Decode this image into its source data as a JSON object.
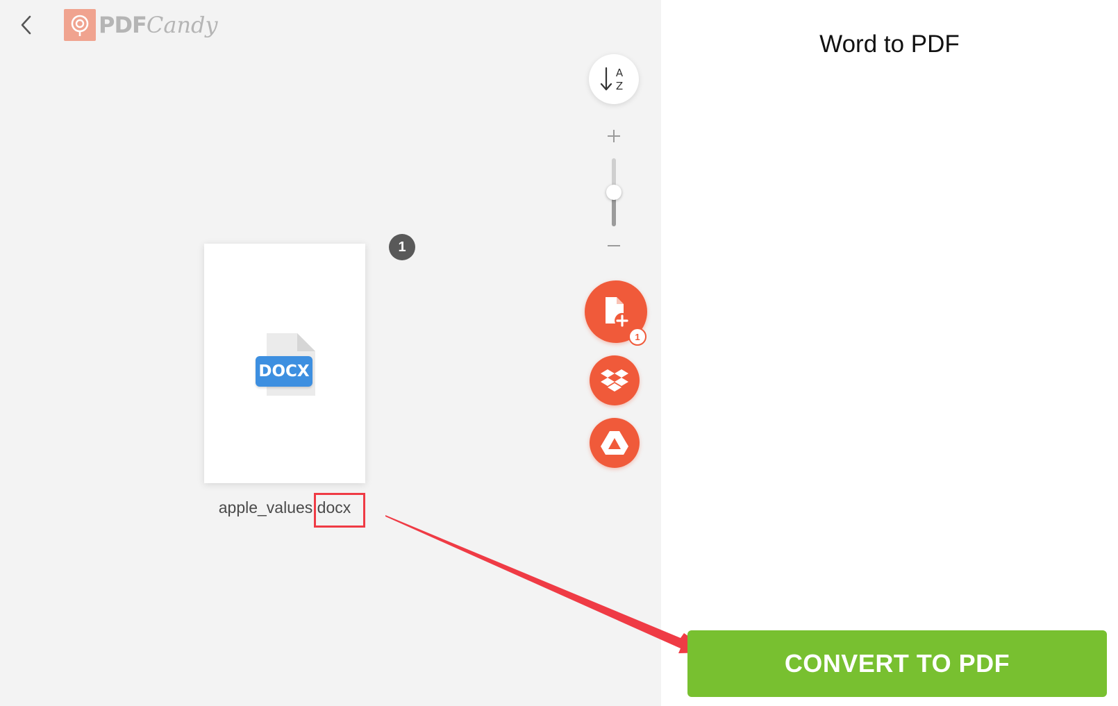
{
  "header": {
    "logo_pdf": "PDF",
    "logo_candy": "Candy"
  },
  "toolbar": {
    "sort_icon": "sort-alpha-down-icon",
    "zoom": {
      "level": 0.5,
      "plus_icon": "plus-icon",
      "minus_icon": "minus-icon"
    },
    "add_file_count": "1",
    "add_icon": "file-add-icon",
    "dropbox_icon": "dropbox-icon",
    "drive_icon": "google-drive-icon"
  },
  "file": {
    "index": "1",
    "type_badge": "DOCX",
    "name": "apple_values.docx"
  },
  "panel": {
    "title": "Word to PDF",
    "convert_label": "CONVERT TO PDF"
  },
  "colors": {
    "accent_orange": "#f05a3a",
    "convert_green": "#78c030",
    "highlight_red": "#ef3b45",
    "docx_blue": "#3d8fe0"
  }
}
